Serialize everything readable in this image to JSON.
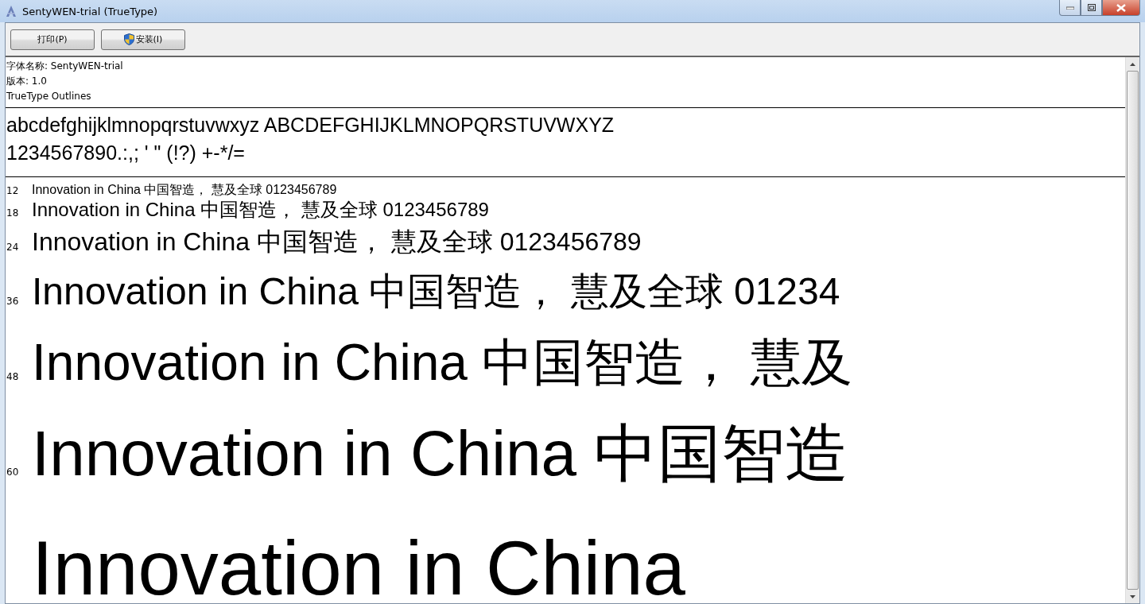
{
  "window": {
    "title": "SentyWEN-trial (TrueType)"
  },
  "toolbar": {
    "buttons": [
      {
        "label": "打印(P)",
        "kind": "plain"
      },
      {
        "label": "安装(I)",
        "kind": "shield"
      }
    ]
  },
  "font_info": [
    "字体名称: SentyWEN-trial",
    "版本: 1.0",
    "TrueType Outlines"
  ],
  "charset": [
    "abcdefghijklmnopqrstuvwxyz ABCDEFGHIJKLMNOPQRSTUVWXYZ",
    "1234567890.:,; ' \" (!?) +-*/="
  ],
  "samples": [
    {
      "size": "12",
      "text": "Innovation in China 中国智造， 慧及全球 0123456789"
    },
    {
      "size": "18",
      "text": "Innovation in China 中国智造， 慧及全球 0123456789"
    },
    {
      "size": "24",
      "text": "Innovation in China 中国智造， 慧及全球 0123456789"
    },
    {
      "size": "36",
      "text": "Innovation in China 中国智造， 慧及全球 01234"
    },
    {
      "size": "48",
      "text": "Innovation in China 中国智造， 慧及"
    },
    {
      "size": "60",
      "text": "Innovation in China 中国智造"
    },
    {
      "text": "Innovation in China"
    }
  ]
}
